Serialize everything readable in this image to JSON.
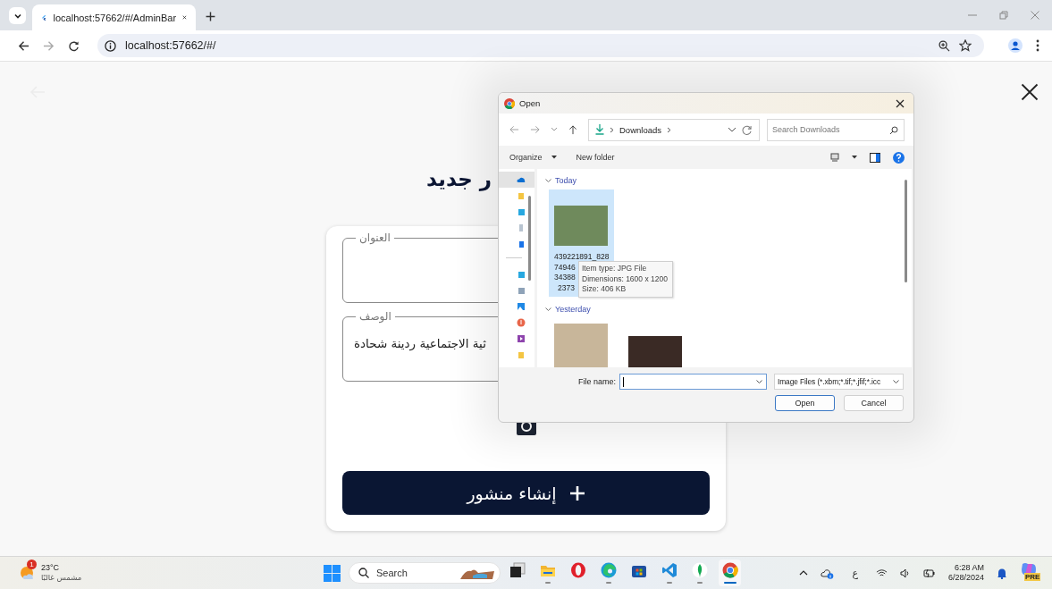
{
  "browser": {
    "tabs": [
      {
        "title": "localhost:57662/#/AdminBar",
        "selected": true
      }
    ],
    "address": {
      "url": "localhost:57662/#/",
      "forward_disabled": true
    }
  },
  "page": {
    "heading": "ر جديد",
    "fields": [
      {
        "label": "العنوان"
      },
      {
        "label": "الوصف",
        "value": "ثية الاجتماعية ردينة شحادة"
      }
    ],
    "submit": {
      "label": "إنشاء منشور"
    }
  },
  "dialog": {
    "title": "Open",
    "location": "Downloads",
    "search": {
      "placeholder": "Search Downloads"
    },
    "toolbar": {
      "organize": "Organize",
      "new_folder": "New folder"
    },
    "nav_groups": [
      [
        {
          "kind": "cloud",
          "selected": true
        },
        {
          "kind": "folder",
          "selected": false
        },
        {
          "kind": "desktop",
          "selected": false
        },
        {
          "kind": "document",
          "selected": false
        },
        {
          "kind": "download",
          "selected": false
        }
      ],
      [
        {
          "kind": "pc",
          "selected": false
        },
        {
          "kind": "drive",
          "selected": false
        },
        {
          "kind": "pictures",
          "selected": false
        },
        {
          "kind": "music",
          "selected": false
        },
        {
          "kind": "videos",
          "selected": false
        },
        {
          "kind": "folder",
          "selected": false
        }
      ]
    ],
    "groups": [
      {
        "label": "Today",
        "expanded": true,
        "files": [
          {
            "selected": true,
            "name_lines": [
              "439221891_828",
              "74946",
              "34388",
              "2373"
            ]
          }
        ]
      },
      {
        "label": "Yesterday",
        "expanded": true,
        "files": [
          {
            "selected": false
          },
          {
            "selected": false
          }
        ]
      }
    ],
    "tooltip": {
      "lines": [
        "Item type: JPG File",
        "Dimensions: 1600 x 1200",
        "Size: 406 KB"
      ]
    },
    "file_name": {
      "label": "File name:"
    },
    "filter": "Image Files (*.xbm;*.tif;*.jfif;*.icc",
    "buttons": [
      {
        "label": "Open",
        "kind": "default"
      },
      {
        "label": "Cancel",
        "kind": "normal"
      }
    ]
  },
  "taskbar": {
    "weather": {
      "badge": "1",
      "temperature": "23°C",
      "condition": "مشمس غالبًا"
    },
    "search": {
      "placeholder": "Search"
    },
    "apps": [
      {
        "kind": "taskview",
        "running": false,
        "active": false
      },
      {
        "kind": "explorer",
        "running": true,
        "active": false
      },
      {
        "kind": "opera",
        "running": false,
        "active": false
      },
      {
        "kind": "edge",
        "running": true,
        "active": false
      },
      {
        "kind": "store",
        "running": false,
        "active": false
      },
      {
        "kind": "vscode",
        "running": true,
        "active": false
      },
      {
        "kind": "mongodb",
        "running": true,
        "active": false
      },
      {
        "kind": "chrome",
        "running": true,
        "active": true
      }
    ],
    "input_language": "ع",
    "time": "6:28 AM",
    "date": "6/28/2024",
    "copilot_badge": "PRE"
  }
}
